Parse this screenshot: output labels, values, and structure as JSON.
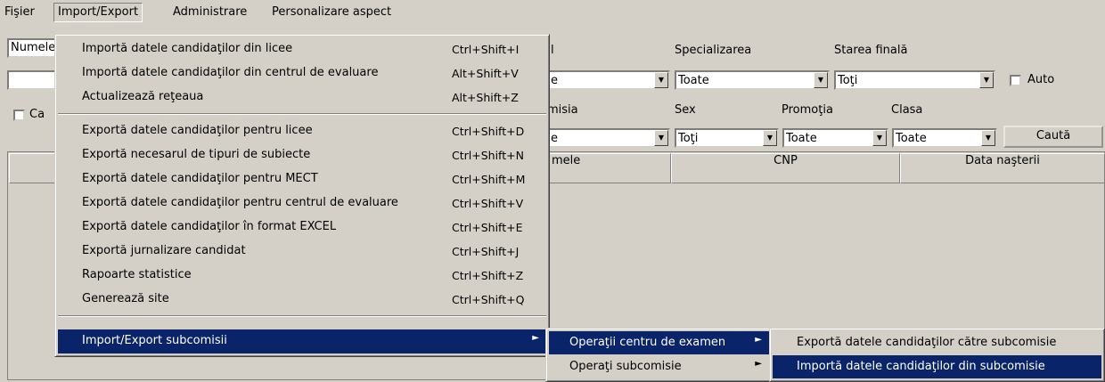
{
  "menubar": {
    "items": [
      "Fişier",
      "Import/Export",
      "Administrare",
      "Personalizare aspect"
    ]
  },
  "form": {
    "left_field_value": "Numele",
    "specializare_label": "Specializarea",
    "stare_label": "Starea finală",
    "specializare_value": "Toate",
    "stare_value": "Toţi",
    "auto_label": "Auto",
    "left_checkbox_label": "Ca",
    "comisia_label": "misia",
    "sex_label": "Sex",
    "promotia_label": "Promoţia",
    "clasa_label": "Clasa",
    "sex_value": "Toţi",
    "promotia_value": "Toate",
    "clasa_value": "Toate",
    "search_button": "Caută",
    "truncated_top_label": "l",
    "truncated_combo_char": "e"
  },
  "grid": {
    "columns": [
      "mele",
      "CNP",
      "Data naşterii"
    ]
  },
  "import_export_menu": {
    "items": [
      {
        "label": "Importă datele candidaţilor din licee",
        "shortcut": "Ctrl+Shift+I"
      },
      {
        "label": "Importă datele candidaţilor din centrul de evaluare",
        "shortcut": "Alt+Shift+V"
      },
      {
        "label": "Actualizează reţeaua",
        "shortcut": "Alt+Shift+Z"
      },
      {
        "label": "Exportă datele candidaţilor pentru licee",
        "shortcut": "Ctrl+Shift+D"
      },
      {
        "label": "Exportă necesarul de tipuri de subiecte",
        "shortcut": "Ctrl+Shift+N"
      },
      {
        "label": "Exportă datele candidaţilor pentru MECT",
        "shortcut": "Ctrl+Shift+M"
      },
      {
        "label": "Exportă datele candidaţilor pentru centrul de evaluare",
        "shortcut": "Ctrl+Shift+V"
      },
      {
        "label": "Exportă datele candidaţilor în format EXCEL",
        "shortcut": "Ctrl+Shift+E"
      },
      {
        "label": "Exportă jurnalizare candidat",
        "shortcut": "Ctrl+Shift+J"
      },
      {
        "label": "Rapoarte statistice",
        "shortcut": "Ctrl+Shift+Z"
      },
      {
        "label": "Generează site",
        "shortcut": "Ctrl+Shift+Q"
      },
      {
        "label": "Import/Export subcomisii",
        "shortcut": ""
      }
    ]
  },
  "subcomisii_menu": {
    "items": [
      "Operaţii centru de examen",
      "Operaţi subcomisie"
    ]
  },
  "centru_menu": {
    "items": [
      "Exportă datele candidaţilor către subcomisie",
      "Importă datele candidaţilor din subcomisie"
    ]
  },
  "colors": {
    "highlight": "#0a246a",
    "face": "#d4d0c8"
  }
}
